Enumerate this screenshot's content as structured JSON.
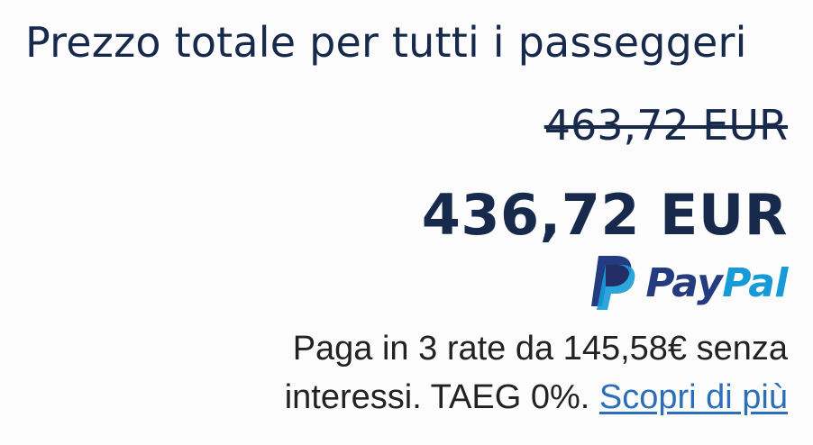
{
  "summary": {
    "title": "Prezzo totale per tutti i passeggeri",
    "original_price": "463,72 EUR",
    "total_price": "436,72 EUR"
  },
  "paypal": {
    "brand_pay": "Pay",
    "brand_pal": "Pal",
    "icon": "paypal-p-icon",
    "colors": {
      "dark": "#253b80",
      "light": "#179bd7"
    },
    "installment_line_1": "Paga in 3 rate da 145,58€ senza",
    "installment_line_2": "interessi. TAEG 0%.",
    "learn_more_label": "Scopri di più"
  },
  "colors": {
    "text_primary": "#172a4c",
    "text_body": "#222222",
    "link": "#2c6fb8"
  }
}
